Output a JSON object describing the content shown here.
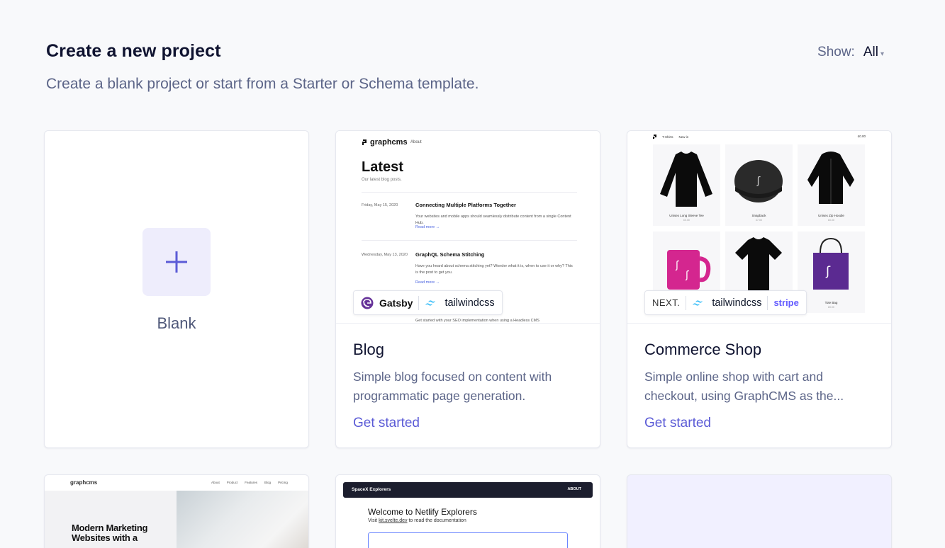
{
  "header": {
    "title": "Create a new project",
    "subtitle": "Create a blank project or start from a Starter or Schema template.",
    "show_label": "Show:",
    "show_value": "All"
  },
  "blank": {
    "label": "Blank"
  },
  "cards": [
    {
      "title": "Blog",
      "description": "Simple blog focused on content with programmatic page generation.",
      "link": "Get started",
      "badges": [
        "Gatsby",
        "tailwindcss"
      ],
      "preview": {
        "logo": "graphcms",
        "nav": "About",
        "heading": "Latest",
        "subheading": "Our latest blog posts.",
        "posts": [
          {
            "date": "Friday, May 15, 2020",
            "title": "Connecting Multiple Platforms Together",
            "text": "Your websites and mobile apps should seamlessly distribute content from a single Content Hub.",
            "more": "Read more →"
          },
          {
            "date": "Wednesday, May 13, 2020",
            "title": "GraphQL Schema Stitching",
            "text": "Have you heard about schema stitching yet? Wonder what it is, when to use it or why? This is the post to get you.",
            "more": "Read more →"
          }
        ],
        "footer_text": "Get started with your SEO implementation when using a Headless CMS"
      }
    },
    {
      "title": "Commerce Shop",
      "description": "Simple online shop with cart and checkout, using GraphCMS as the...",
      "link": "Get started",
      "badges": [
        "NEXT.",
        "tailwindcss",
        "stripe"
      ],
      "preview": {
        "nav": [
          "T-Shirts",
          "New in"
        ],
        "cart": "£0.00",
        "products": [
          {
            "name": "Unisex Long Sleeve Tee",
            "price": "£0.00"
          },
          {
            "name": "Snapback",
            "price": "£7.00"
          },
          {
            "name": "Unisex Zip Hoodie",
            "price": "£0.00"
          },
          {
            "name": "",
            "price": ""
          },
          {
            "name": "",
            "price": ""
          },
          {
            "name": "Tote Bag",
            "price": "£0.00"
          }
        ]
      }
    }
  ],
  "marketing": {
    "logo": "graphcms",
    "nav": [
      "About",
      "Product",
      "Features",
      "Blog",
      "Pricing"
    ],
    "heading_line1": "Modern Marketing",
    "heading_line2": "Websites with a"
  },
  "explorers": {
    "brand": "SpaceX Explorers",
    "about": "ABOUT",
    "heading": "Welcome to Netlify Explorers",
    "visit_prefix": "Visit",
    "visit_link": "kit.svelte.dev",
    "visit_suffix": "to read the documentation"
  },
  "colors": {
    "accent": "#5b5bd6",
    "blank_tile": "#eeedfc",
    "page_bg": "#f8f9fb"
  }
}
